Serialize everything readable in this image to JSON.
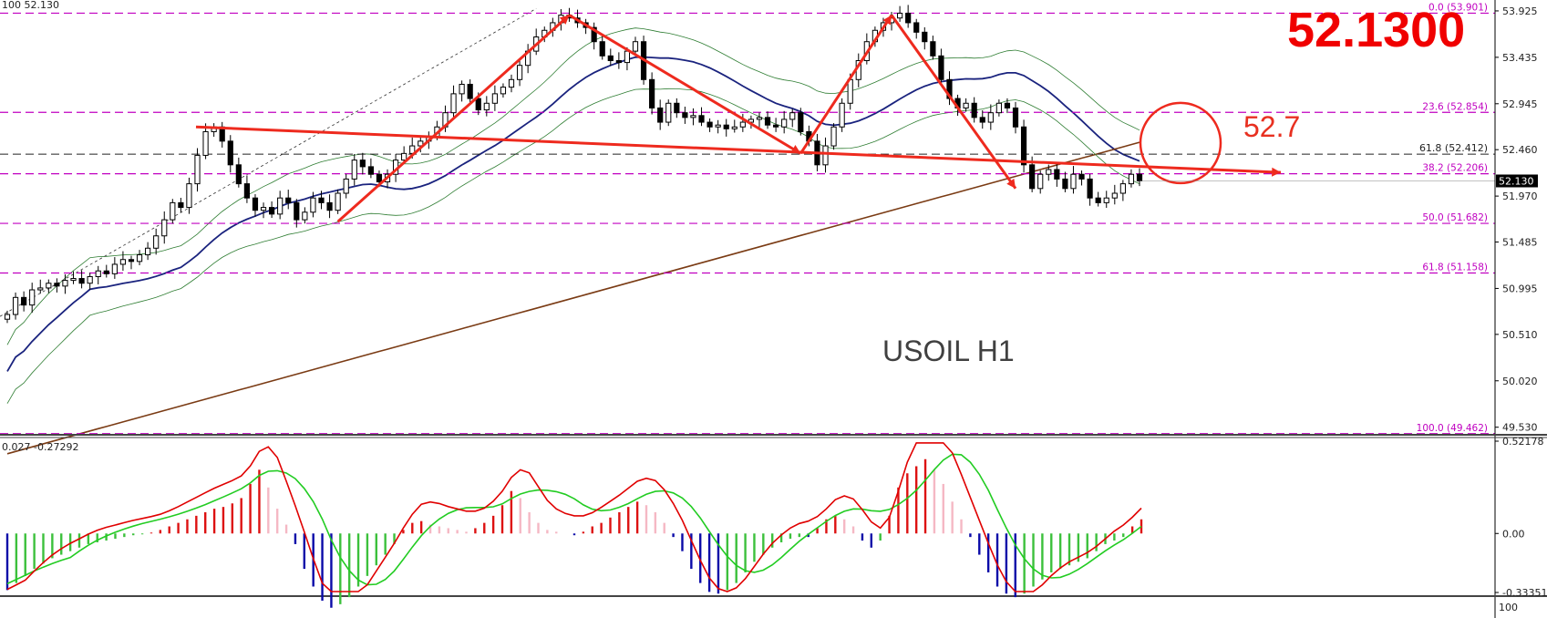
{
  "chart_data": {
    "type": "candlestick",
    "instrument_label": "USOIL  H1",
    "current_price_big": "52.1300",
    "target_label": "52.7",
    "corner_label": "100 52.130",
    "current_price_tag": "52.130",
    "y_axis_ticks": [
      "53.925",
      "53.435",
      "52.945",
      "52.460",
      "51.970",
      "51.485",
      "50.995",
      "50.510",
      "50.020",
      "49.530"
    ],
    "ylim": [
      49.45,
      54.04
    ],
    "fib_levels": [
      {
        "label": "0.0 (53.901)",
        "price": 53.901
      },
      {
        "label": "23.6 (52.854)",
        "price": 52.854
      },
      {
        "label": "38.2 (52.206)",
        "price": 52.206
      },
      {
        "label": "50.0 (51.682)",
        "price": 51.682
      },
      {
        "label": "61.8 (51.158)",
        "price": 51.158
      },
      {
        "label": "100.0 (49.462)",
        "price": 49.462
      }
    ],
    "black_level": {
      "label": "61.8 (52.412)",
      "price": 52.412
    },
    "last_price": 52.13,
    "candles_close": [
      50.72,
      50.9,
      50.82,
      50.98,
      51.0,
      51.05,
      51.02,
      51.08,
      51.1,
      51.05,
      51.12,
      51.18,
      51.15,
      51.25,
      51.3,
      51.28,
      51.35,
      51.42,
      51.55,
      51.72,
      51.9,
      51.85,
      52.1,
      52.4,
      52.65,
      52.7,
      52.55,
      52.3,
      52.1,
      51.95,
      51.82,
      51.85,
      51.78,
      51.95,
      51.9,
      51.72,
      51.8,
      51.95,
      51.9,
      51.82,
      52.0,
      52.15,
      52.35,
      52.28,
      52.2,
      52.12,
      52.2,
      52.35,
      52.42,
      52.5,
      52.55,
      52.6,
      52.7,
      52.85,
      53.05,
      53.15,
      53.0,
      52.88,
      52.95,
      53.05,
      53.12,
      53.2,
      53.35,
      53.5,
      53.65,
      53.72,
      53.8,
      53.88,
      53.85,
      53.8,
      53.75,
      53.6,
      53.45,
      53.4,
      53.38,
      53.5,
      53.6,
      53.2,
      52.9,
      52.75,
      52.95,
      52.85,
      52.8,
      52.82,
      52.75,
      52.7,
      52.72,
      52.68,
      52.7,
      52.75,
      52.78,
      52.8,
      52.72,
      52.7,
      52.78,
      52.85,
      52.65,
      52.55,
      52.3,
      52.5,
      52.7,
      52.95,
      53.2,
      53.4,
      53.6,
      53.72,
      53.8,
      53.85,
      53.9,
      53.8,
      53.7,
      53.6,
      53.45,
      53.2,
      53.0,
      52.9,
      52.95,
      52.8,
      52.75,
      52.85,
      52.95,
      52.9,
      52.7,
      52.3,
      52.05,
      52.2,
      52.25,
      52.15,
      52.05,
      52.2,
      52.15,
      51.95,
      51.9,
      51.95,
      52.0,
      52.1,
      52.2,
      52.13
    ],
    "indicator": {
      "label": "0.027 -0.27292",
      "y_ticks": [
        "0.52178",
        "0.00",
        "-0.33351"
      ],
      "histogram": [
        -0.32,
        -0.28,
        -0.24,
        -0.2,
        -0.17,
        -0.14,
        -0.12,
        -0.1,
        -0.08,
        -0.06,
        -0.05,
        -0.04,
        -0.03,
        -0.02,
        -0.01,
        -0.005,
        0.005,
        0.02,
        0.04,
        0.06,
        0.08,
        0.1,
        0.12,
        0.14,
        0.15,
        0.17,
        0.2,
        0.28,
        0.36,
        0.26,
        0.14,
        0.05,
        -0.06,
        -0.2,
        -0.3,
        -0.38,
        -0.42,
        -0.4,
        -0.36,
        -0.3,
        -0.24,
        -0.18,
        -0.12,
        -0.06,
        0.02,
        0.06,
        0.07,
        0.05,
        0.04,
        0.03,
        0.02,
        0.01,
        0.03,
        0.06,
        0.1,
        0.16,
        0.24,
        0.2,
        0.12,
        0.06,
        0.02,
        0.01,
        0.0,
        -0.01,
        0.01,
        0.04,
        0.06,
        0.09,
        0.12,
        0.15,
        0.18,
        0.16,
        0.12,
        0.06,
        -0.02,
        -0.1,
        -0.2,
        -0.28,
        -0.33,
        -0.34,
        -0.32,
        -0.28,
        -0.22,
        -0.16,
        -0.12,
        -0.08,
        -0.05,
        -0.03,
        -0.02,
        -0.02,
        0.03,
        0.08,
        0.1,
        0.08,
        0.04,
        -0.04,
        -0.08,
        -0.04,
        0.1,
        0.26,
        0.34,
        0.38,
        0.42,
        0.36,
        0.28,
        0.18,
        0.08,
        -0.02,
        -0.12,
        -0.22,
        -0.3,
        -0.34,
        -0.36,
        -0.34,
        -0.3,
        -0.26,
        -0.22,
        -0.2,
        -0.18,
        -0.16,
        -0.14,
        -0.1,
        -0.06,
        -0.04,
        -0.02,
        0.04,
        0.08
      ]
    }
  },
  "colors": {
    "bull_candle": "#000000",
    "bear_candle": "#000000",
    "ma_fast": "#1a237e",
    "ma_slow": "#7a3b14",
    "bollinger": "#2e7d32",
    "fib": "#c000c0",
    "red_annotation": "#ee2a1e",
    "macd_red": "#e00000",
    "macd_green": "#22cc22",
    "hist_up_strong": "#dd1111",
    "hist_up_weak": "#f5b8c4",
    "hist_down_strong": "#0a0aa8",
    "hist_down_weak": "#3cc03c"
  },
  "icons": [
    "target-circle",
    "trend-arrow"
  ]
}
